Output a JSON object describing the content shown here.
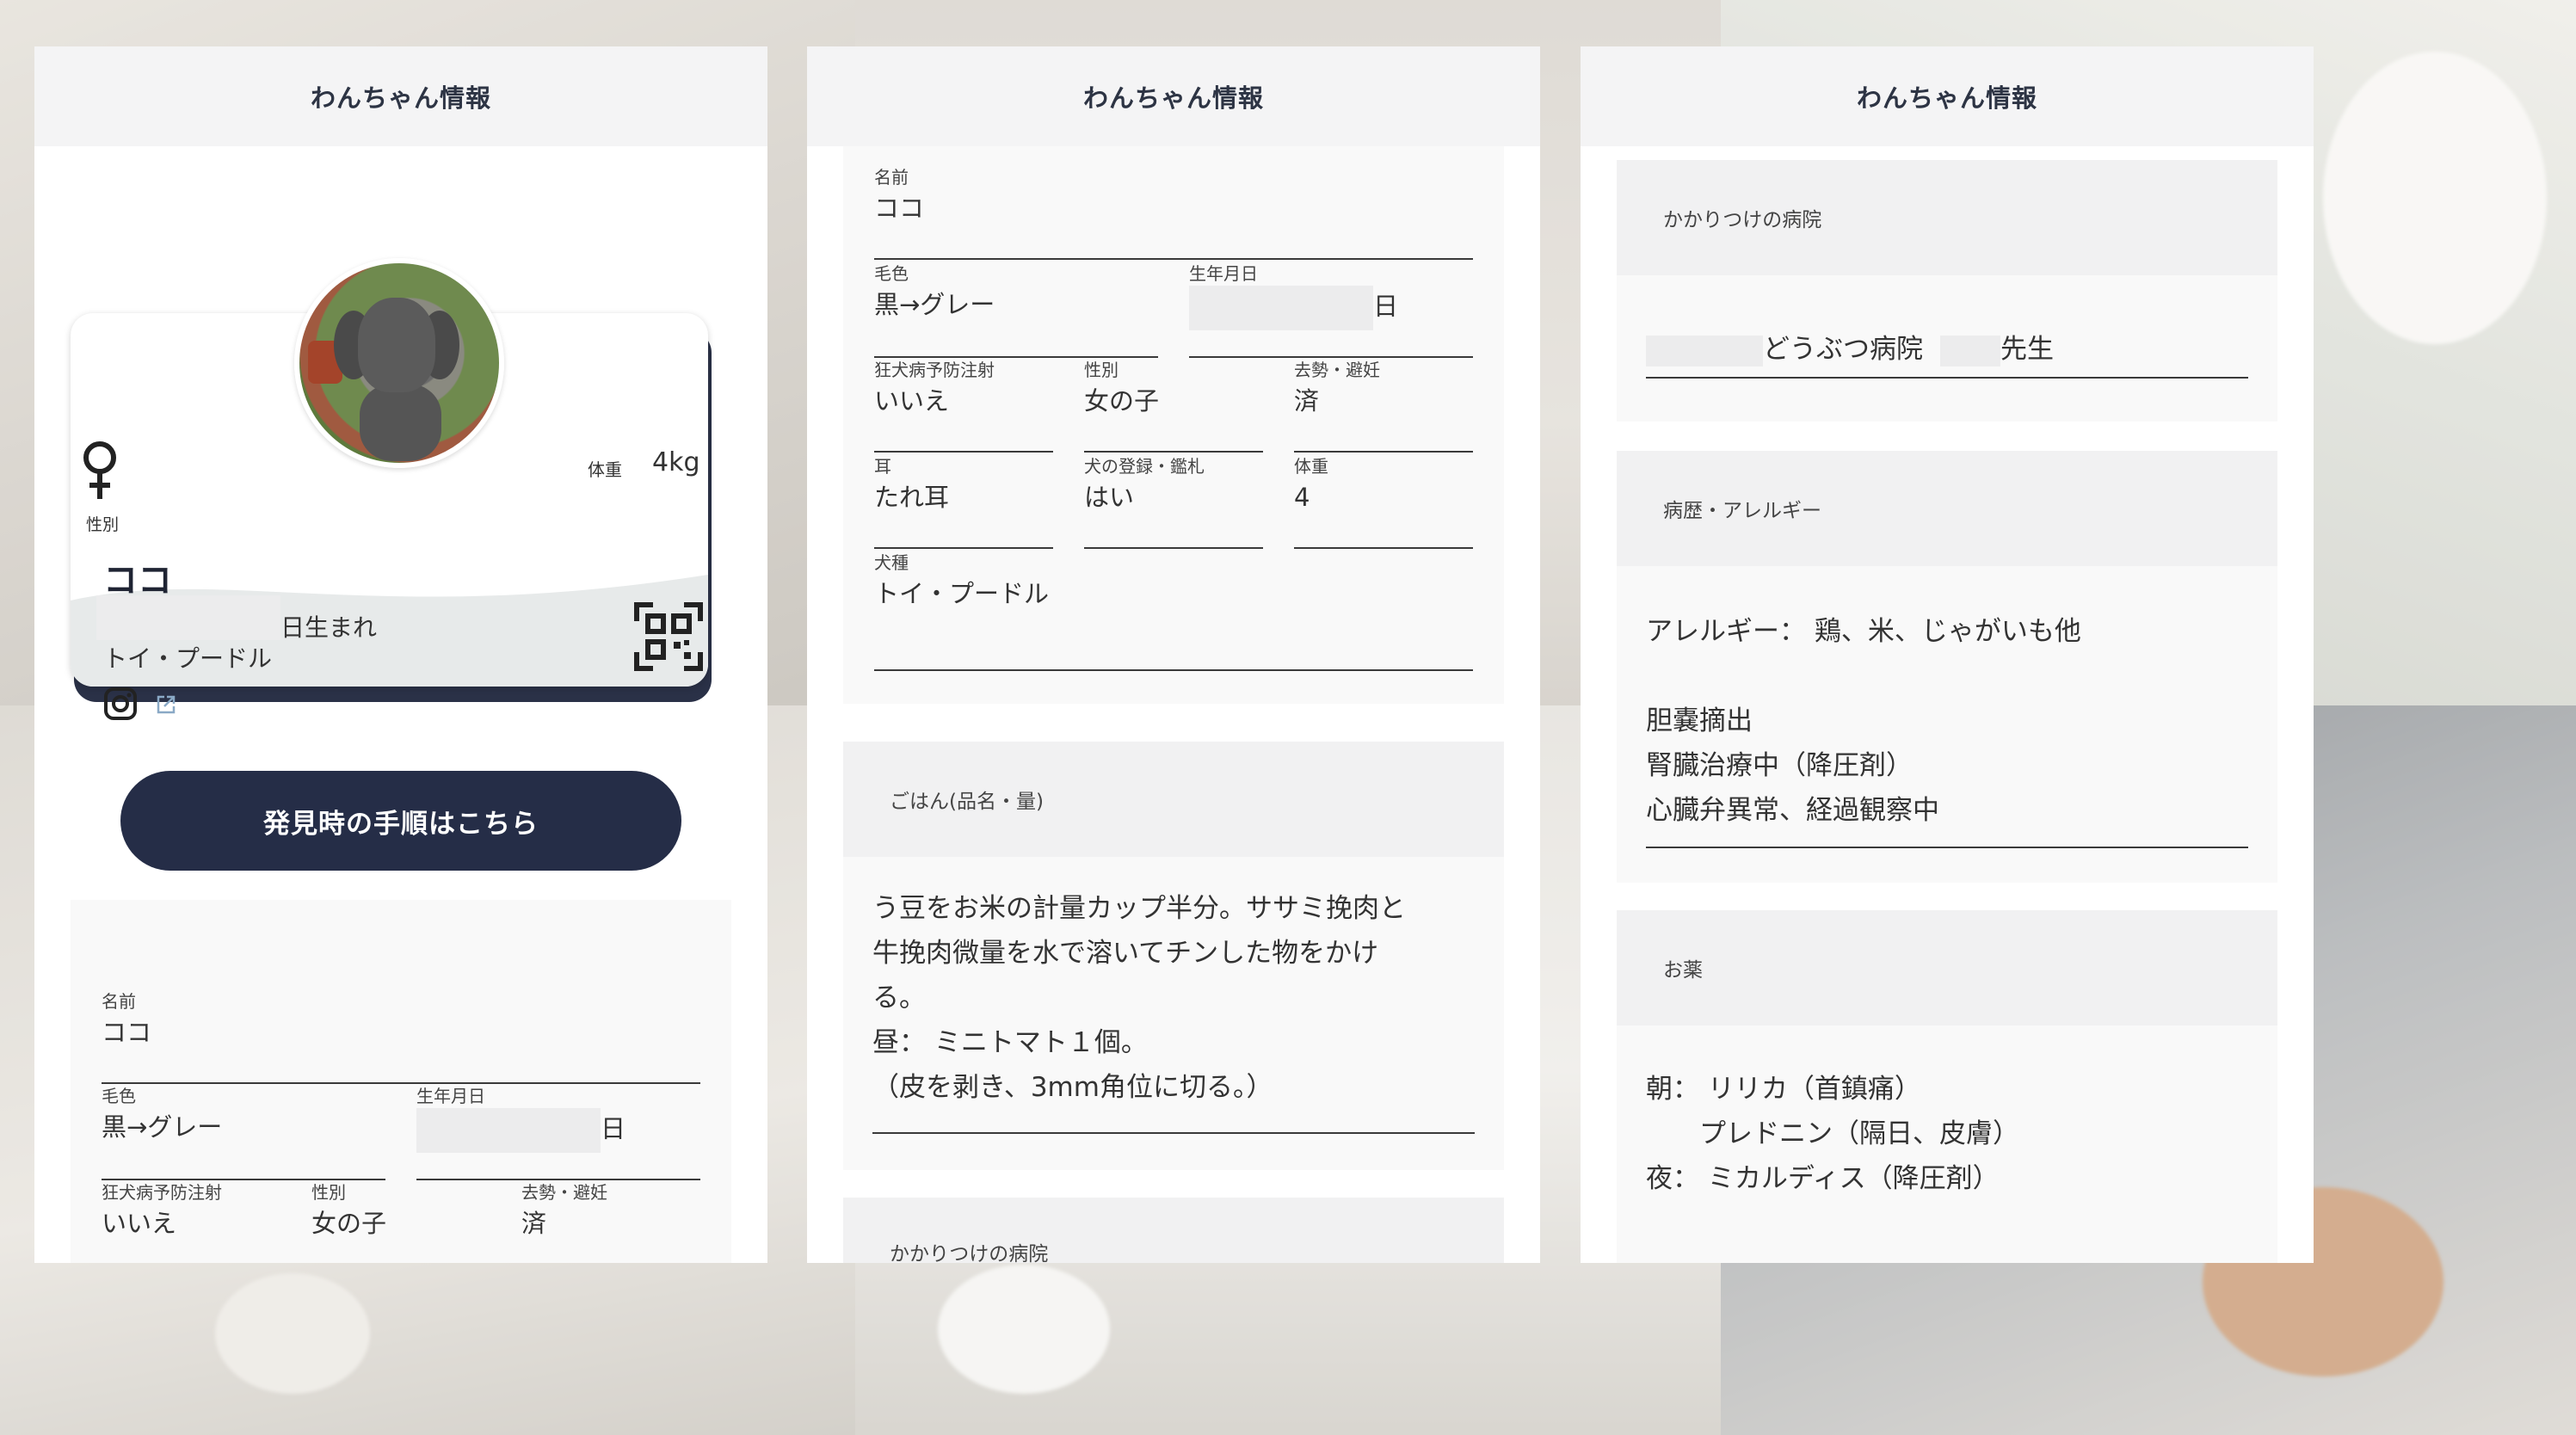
{
  "panel_title": "わんちゃん情報",
  "profile": {
    "sex_label": "性別",
    "weight_label": "体重",
    "weight_value": "4kg",
    "name": "ココ",
    "born_suffix": "日生まれ",
    "breed": "トイ・プードル",
    "icons": [
      "female-icon",
      "qr-code-icon",
      "instagram-icon",
      "external-link-icon"
    ]
  },
  "found_button": "発見時の手順はこちら",
  "fields": {
    "name": {
      "label": "名前",
      "value": "ココ"
    },
    "coat": {
      "label": "毛色",
      "value": "黒→グレー"
    },
    "birthday": {
      "label": "生年月日",
      "suffix": "日"
    },
    "rabies": {
      "label": "狂犬病予防注射",
      "value": "いいえ"
    },
    "sex": {
      "label": "性別",
      "value": "女の子"
    },
    "neuter": {
      "label": "去勢・避妊",
      "value": "済"
    },
    "ears": {
      "label": "耳",
      "value": "たれ耳"
    },
    "registration": {
      "label": "犬の登録・鑑札",
      "value": "はい"
    },
    "weight": {
      "label": "体重",
      "value": "4"
    },
    "breed": {
      "label": "犬種",
      "value": "トイ・プードル"
    }
  },
  "food": {
    "label": "ごはん(品名・量)",
    "lines": [
      "う豆をお米の計量カップ半分。ササミ挽肉と",
      "牛挽肉微量を水で溶いてチンした物をかけ",
      "る。",
      "昼： ミニトマト１個。",
      "（皮を剥き、3mm角位に切る。）"
    ]
  },
  "hospital": {
    "label": "かかりつけの病院",
    "hospital_suffix": "どうぶつ病院",
    "doctor_suffix": "先生"
  },
  "history": {
    "label": "病歴・アレルギー",
    "lines": [
      "アレルギー： 鶏、米、じゃがいも他",
      "",
      "胆嚢摘出",
      "腎臓治療中（降圧剤）",
      "心臓弁異常、経過観察中"
    ]
  },
  "medicine": {
    "label": "お薬",
    "lines": [
      "朝： リリカ（首鎮痛）",
      "　　プレドニン（隔日、皮膚）",
      "夜： ミカルディス（降圧剤）"
    ]
  },
  "colors": {
    "navy": "#252d47",
    "header_bg": "#f4f4f5"
  }
}
